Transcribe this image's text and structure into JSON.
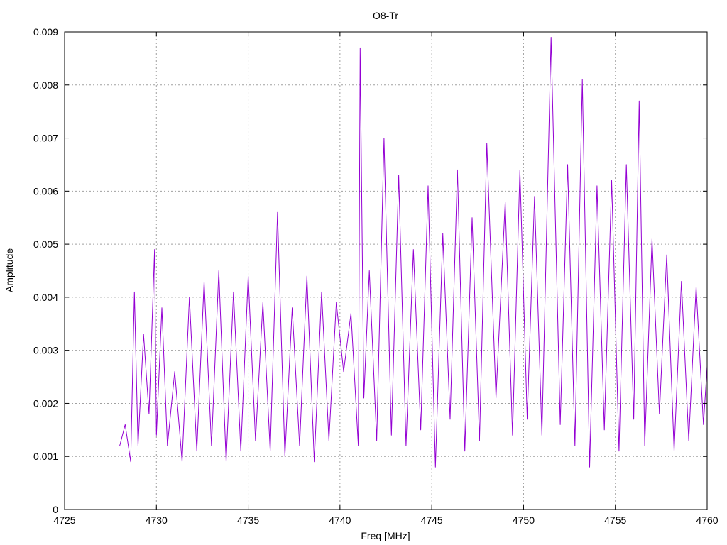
{
  "chart_data": {
    "type": "line",
    "title": "O8-Tr",
    "xlabel": "Freq [MHz]",
    "ylabel": "Amplitude",
    "xlim": [
      4725,
      4760
    ],
    "ylim": [
      0,
      0.009
    ],
    "xticks": [
      4725,
      4730,
      4735,
      4740,
      4745,
      4750,
      4755,
      4760
    ],
    "xtick_labels": [
      "4725",
      "4730",
      "4735",
      "4740",
      "4745",
      "4750",
      "4755",
      "4760"
    ],
    "yticks": [
      0,
      0.001,
      0.002,
      0.003,
      0.004,
      0.005,
      0.006,
      0.007,
      0.008,
      0.009
    ],
    "ytick_labels": [
      "0",
      "0.001",
      "0.002",
      "0.003",
      "0.004",
      "0.005",
      "0.006",
      "0.007",
      "0.008",
      "0.009"
    ],
    "grid": true,
    "legend": "none",
    "series": [
      {
        "color": "#9400d3",
        "x": [
          4728.0,
          4728.3,
          4728.6,
          4728.8,
          4729.0,
          4729.3,
          4729.6,
          4729.9,
          4730.0,
          4730.3,
          4730.6,
          4731.0,
          4731.4,
          4731.8,
          4732.2,
          4732.6,
          4733.0,
          4733.4,
          4733.8,
          4734.2,
          4734.6,
          4735.0,
          4735.4,
          4735.8,
          4736.2,
          4736.6,
          4737.0,
          4737.4,
          4737.8,
          4738.2,
          4738.6,
          4739.0,
          4739.4,
          4739.8,
          4740.2,
          4740.6,
          4741.0,
          4741.1,
          4741.3,
          4741.6,
          4742.0,
          4742.4,
          4742.8,
          4743.2,
          4743.6,
          4744.0,
          4744.4,
          4744.8,
          4745.2,
          4745.6,
          4746.0,
          4746.4,
          4746.8,
          4747.2,
          4747.6,
          4748.0,
          4748.5,
          4749.0,
          4749.4,
          4749.8,
          4750.2,
          4750.6,
          4751.0,
          4751.5,
          4752.0,
          4752.4,
          4752.8,
          4753.2,
          4753.6,
          4754.0,
          4754.4,
          4754.8,
          4755.2,
          4755.6,
          4756.0,
          4756.3,
          4756.6,
          4757.0,
          4757.4,
          4757.8,
          4758.2,
          4758.6,
          4759.0,
          4759.4,
          4759.8,
          4760.0
        ],
        "y": [
          0.0012,
          0.0016,
          0.0009,
          0.0041,
          0.0012,
          0.0033,
          0.0018,
          0.0049,
          0.0014,
          0.0038,
          0.0012,
          0.0026,
          0.0009,
          0.004,
          0.0011,
          0.0043,
          0.0012,
          0.0045,
          0.0009,
          0.0041,
          0.0011,
          0.0044,
          0.0013,
          0.0039,
          0.0011,
          0.0056,
          0.001,
          0.0038,
          0.0012,
          0.0044,
          0.0009,
          0.0041,
          0.0013,
          0.0039,
          0.0026,
          0.0037,
          0.0012,
          0.0087,
          0.0021,
          0.0045,
          0.0013,
          0.007,
          0.0014,
          0.0063,
          0.0012,
          0.0049,
          0.0015,
          0.0061,
          0.0008,
          0.0052,
          0.0017,
          0.0064,
          0.0011,
          0.0055,
          0.0013,
          0.0069,
          0.0021,
          0.0058,
          0.0014,
          0.0064,
          0.0017,
          0.0059,
          0.0014,
          0.0089,
          0.0016,
          0.0065,
          0.0012,
          0.0081,
          0.0008,
          0.0061,
          0.0015,
          0.0062,
          0.0011,
          0.0065,
          0.0017,
          0.0077,
          0.0012,
          0.0051,
          0.0018,
          0.0048,
          0.0011,
          0.0043,
          0.0013,
          0.0042,
          0.0016,
          0.0027
        ]
      }
    ]
  }
}
